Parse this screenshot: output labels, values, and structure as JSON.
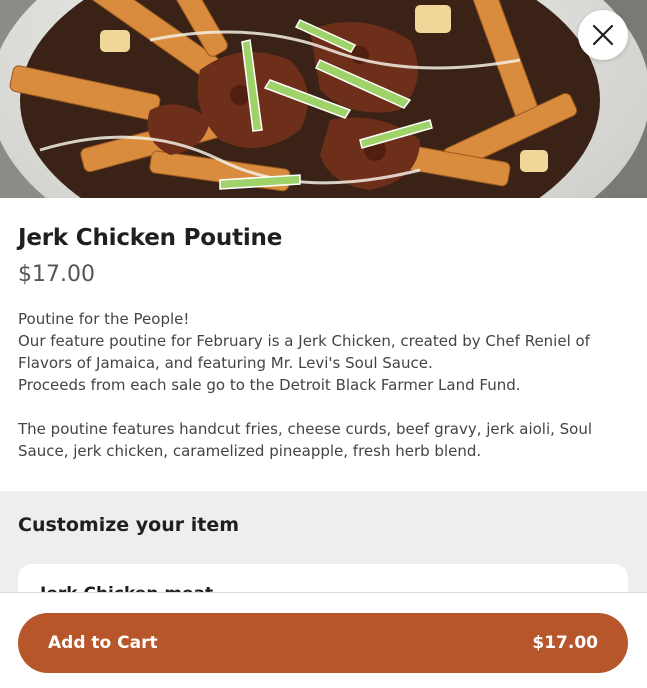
{
  "hero": {
    "image_name": "jerk-chicken-poutine-photo"
  },
  "close": {
    "icon": "close-icon"
  },
  "item": {
    "title": "Jerk Chicken Poutine",
    "price": "$17.00",
    "description": [
      "Poutine for the People!",
      "Our feature poutine for February is a Jerk Chicken, created by Chef Reniel of",
      "Flavors of Jamaica, and featuring Mr. Levi's Soul Sauce.",
      "Proceeds from each sale go to the Detroit Black Farmer Land Fund.",
      "",
      "The poutine features handcut fries, cheese curds, beef gravy, jerk aioli, Soul",
      "Sauce, jerk chicken, caramelized pineapple, fresh herb blend."
    ]
  },
  "customize": {
    "title": "Customize your item",
    "first_option_label": "Jerk Chicken meat"
  },
  "footer": {
    "add_to_cart_label": "Add to Cart",
    "total_price": "$17.00"
  },
  "colors": {
    "accent": "#b6562a",
    "customize_bg": "#eeeef0",
    "text_primary": "#1f1f1f",
    "text_secondary": "#555555"
  }
}
